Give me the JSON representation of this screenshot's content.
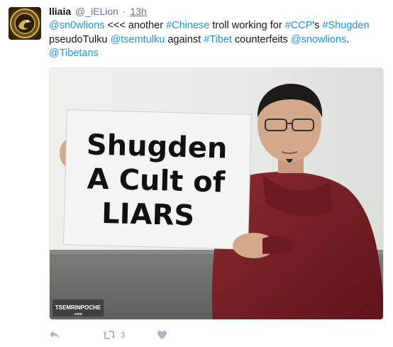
{
  "tweet": {
    "name": "lliaia",
    "handle": "@_iELion",
    "separator": "·",
    "time": "13h",
    "text_parts": [
      {
        "text": "@sn0wlions",
        "link": true
      },
      {
        "text": " <<< another ",
        "link": false
      },
      {
        "text": "#Chinese",
        "link": true
      },
      {
        "text": " troll working for ",
        "link": false
      },
      {
        "text": "#CCP",
        "link": true
      },
      {
        "text": "'s ",
        "link": false
      },
      {
        "text": "#Shugden",
        "link": true
      },
      {
        "text": " pseudoTulku ",
        "link": false
      },
      {
        "text": "@tsemtulku",
        "link": true
      },
      {
        "text": " against ",
        "link": false
      },
      {
        "text": "#Tibet",
        "link": true
      },
      {
        "text": " counterfeits ",
        "link": false
      },
      {
        "text": "@snowlions",
        "link": true
      },
      {
        "text": ". ",
        "link": false
      },
      {
        "text": "@Tibetans",
        "link": true
      }
    ]
  },
  "media": {
    "sign_lines": [
      "Shugden",
      "A Cult of",
      "LIARS"
    ],
    "watermark": "TSEMRINPOCHE",
    "watermark_sub": ".com"
  },
  "actions": {
    "reply_icon": "reply-icon",
    "retweet_icon": "retweet-icon",
    "retweet_count": "3",
    "like_icon": "heart-icon"
  },
  "colors": {
    "link": "#1b95e0",
    "text": "#14171a",
    "muted": "#657786",
    "action": "#aab8c2",
    "robe": "#7a1f25"
  }
}
